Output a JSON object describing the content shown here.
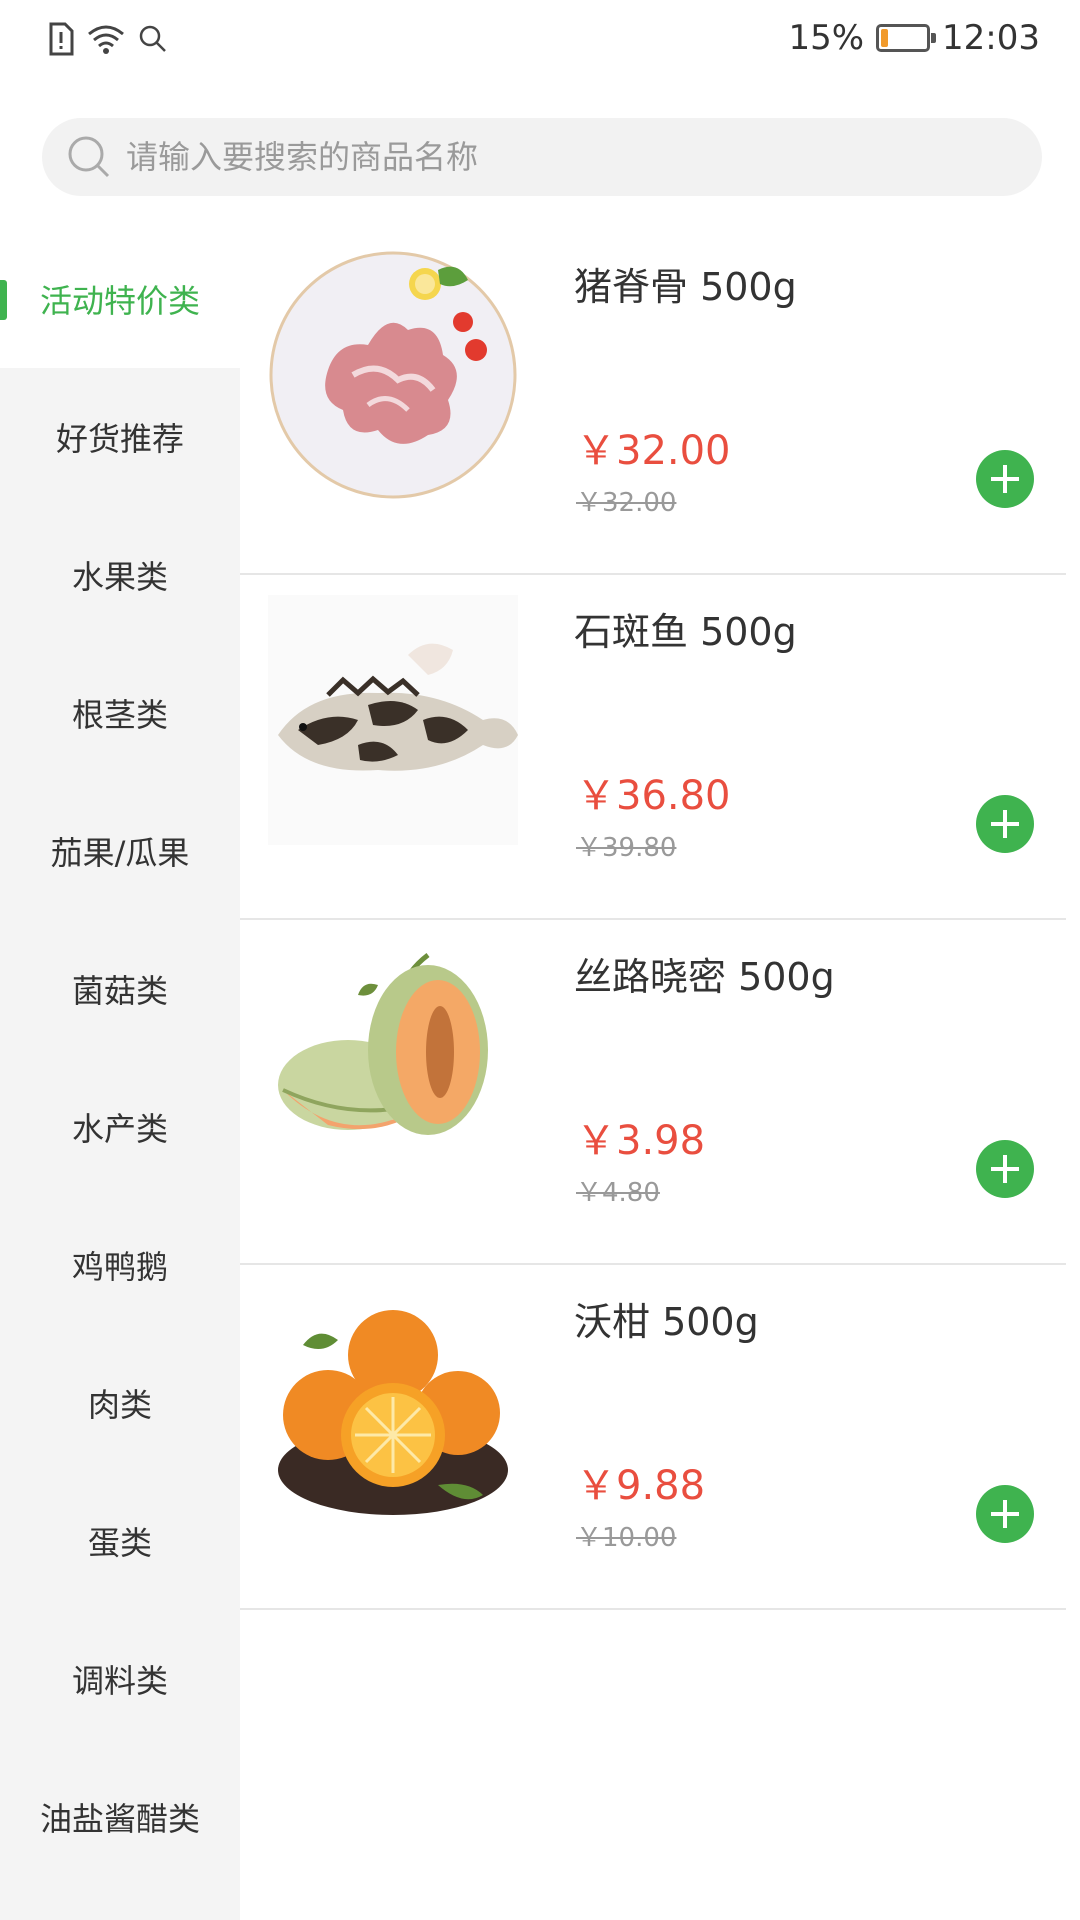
{
  "status_bar": {
    "battery_percent": "15%",
    "battery_level": 0.15,
    "time": "12:03",
    "icons": [
      "sim-alert-icon",
      "wifi-icon",
      "search-icon"
    ]
  },
  "search": {
    "placeholder": "请输入要搜索的商品名称"
  },
  "sidebar": {
    "items": [
      {
        "label": "活动特价类",
        "active": true
      },
      {
        "label": "好货推荐",
        "active": false
      },
      {
        "label": "水果类",
        "active": false
      },
      {
        "label": "根茎类",
        "active": false
      },
      {
        "label": "茄果/瓜果",
        "active": false
      },
      {
        "label": "菌菇类",
        "active": false
      },
      {
        "label": "水产类",
        "active": false
      },
      {
        "label": "鸡鸭鹅",
        "active": false
      },
      {
        "label": "肉类",
        "active": false
      },
      {
        "label": "蛋类",
        "active": false
      },
      {
        "label": "调料类",
        "active": false
      },
      {
        "label": "油盐酱醋类",
        "active": false
      }
    ]
  },
  "products": [
    {
      "name": "猪脊骨 500g",
      "price": "￥32.00",
      "original_price": "￥32.00",
      "image": "pork-bone-image"
    },
    {
      "name": "石斑鱼 500g",
      "price": "￥36.80",
      "original_price": "￥39.80",
      "image": "grouper-fish-image"
    },
    {
      "name": "丝路晓密 500g",
      "price": "￥3.98",
      "original_price": "￥4.80",
      "image": "melon-image"
    },
    {
      "name": "沃柑 500g",
      "price": "￥9.88",
      "original_price": "￥10.00",
      "image": "orange-image"
    }
  ],
  "colors": {
    "accent": "#3fb34f",
    "price": "#e94e3f",
    "sidebar_bg": "#f4f4f4"
  }
}
